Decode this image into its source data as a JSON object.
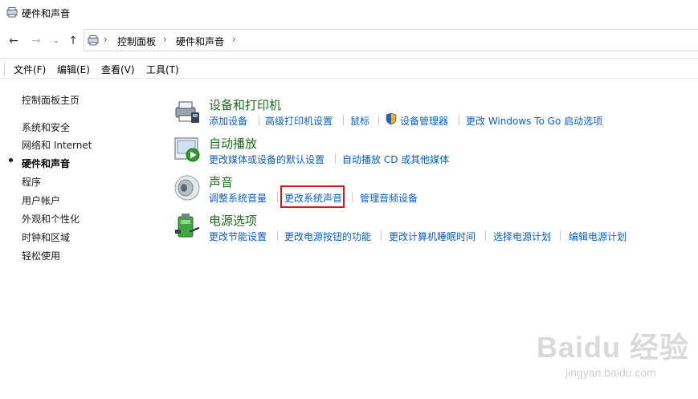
{
  "window": {
    "title": "硬件和声音"
  },
  "address": {
    "crumbs": [
      "控制面板",
      "硬件和声音"
    ]
  },
  "menu": [
    "文件(F)",
    "编辑(E)",
    "查看(V)",
    "工具(T)"
  ],
  "sidebar": {
    "home": "控制面板主页",
    "items": [
      "系统和安全",
      "网络和 Internet",
      "硬件和声音",
      "程序",
      "用户帐户",
      "外观和个性化",
      "时钟和区域",
      "轻松使用"
    ]
  },
  "categories": [
    {
      "title": "设备和打印机",
      "links": [
        "添加设备",
        "高级打印机设置",
        "鼠标",
        "设备管理器",
        "更改 Windows To Go 启动选项"
      ]
    },
    {
      "title": "自动播放",
      "links": [
        "更改媒体或设备的默认设置",
        "自动播放 CD 或其他媒体"
      ]
    },
    {
      "title": "声音",
      "links": [
        "调整系统音量",
        "更改系统声音",
        "管理音频设备"
      ]
    },
    {
      "title": "电源选项",
      "links": [
        "更改节能设置",
        "更改电源按钮的功能",
        "更改计算机睡眠时间",
        "选择电源计划",
        "编辑电源计划"
      ]
    }
  ],
  "watermark": {
    "logo": "Baidu 经验",
    "url": "jingyan.baidu.com"
  }
}
